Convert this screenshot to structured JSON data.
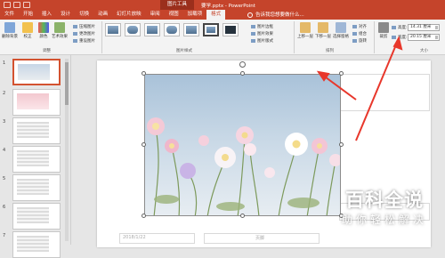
{
  "window": {
    "context_tab_group": "图片工具",
    "document_title": "要学.pptx - PowerPoint",
    "tell_me": "告诉我您想要做什么..."
  },
  "tabs": [
    "文件",
    "开始",
    "插入",
    "设计",
    "切换",
    "动画",
    "幻灯片放映",
    "审阅",
    "视图",
    "加载项",
    "格式"
  ],
  "active_tab": "格式",
  "ribbon": {
    "adjust": {
      "buttons": [
        "删除背景",
        "校正",
        "颜色",
        "艺术效果"
      ],
      "small_items": [
        "压缩图片",
        "更改图片",
        "重设图片"
      ],
      "group_label": "调整"
    },
    "picture_styles": {
      "small_items": [
        "图片边框",
        "图片效果",
        "图片版式"
      ],
      "group_label": "图片样式"
    },
    "arrange": {
      "buttons": [
        "上移一层",
        "下移一层",
        "选择窗格"
      ],
      "small_items": [
        "对齐",
        "组合",
        "旋转"
      ],
      "group_label": "排列"
    },
    "size": {
      "crop_label": "裁剪",
      "height_label": "高度:",
      "height_value": "14.31 厘米",
      "width_label": "宽度:",
      "width_value": "20.15 厘米",
      "group_label": "大小"
    }
  },
  "slides": [
    {
      "number": "1",
      "style": "photo"
    },
    {
      "number": "2",
      "style": "pink"
    },
    {
      "number": "3",
      "style": "grey"
    },
    {
      "number": "4",
      "style": "grey"
    },
    {
      "number": "5",
      "style": "grey"
    },
    {
      "number": "6",
      "style": "grey"
    },
    {
      "number": "7",
      "style": "grey"
    }
  ],
  "selected_slide": "1",
  "slide": {
    "footer_date": "2018/1/22",
    "footer_text": "页脚"
  },
  "watermark": {
    "main": "百科全说",
    "sub": "助你轻松解决"
  },
  "colors": {
    "accent": "#c5442b",
    "annotation_arrow": "#e8372b",
    "selection_border": "#d35230"
  }
}
